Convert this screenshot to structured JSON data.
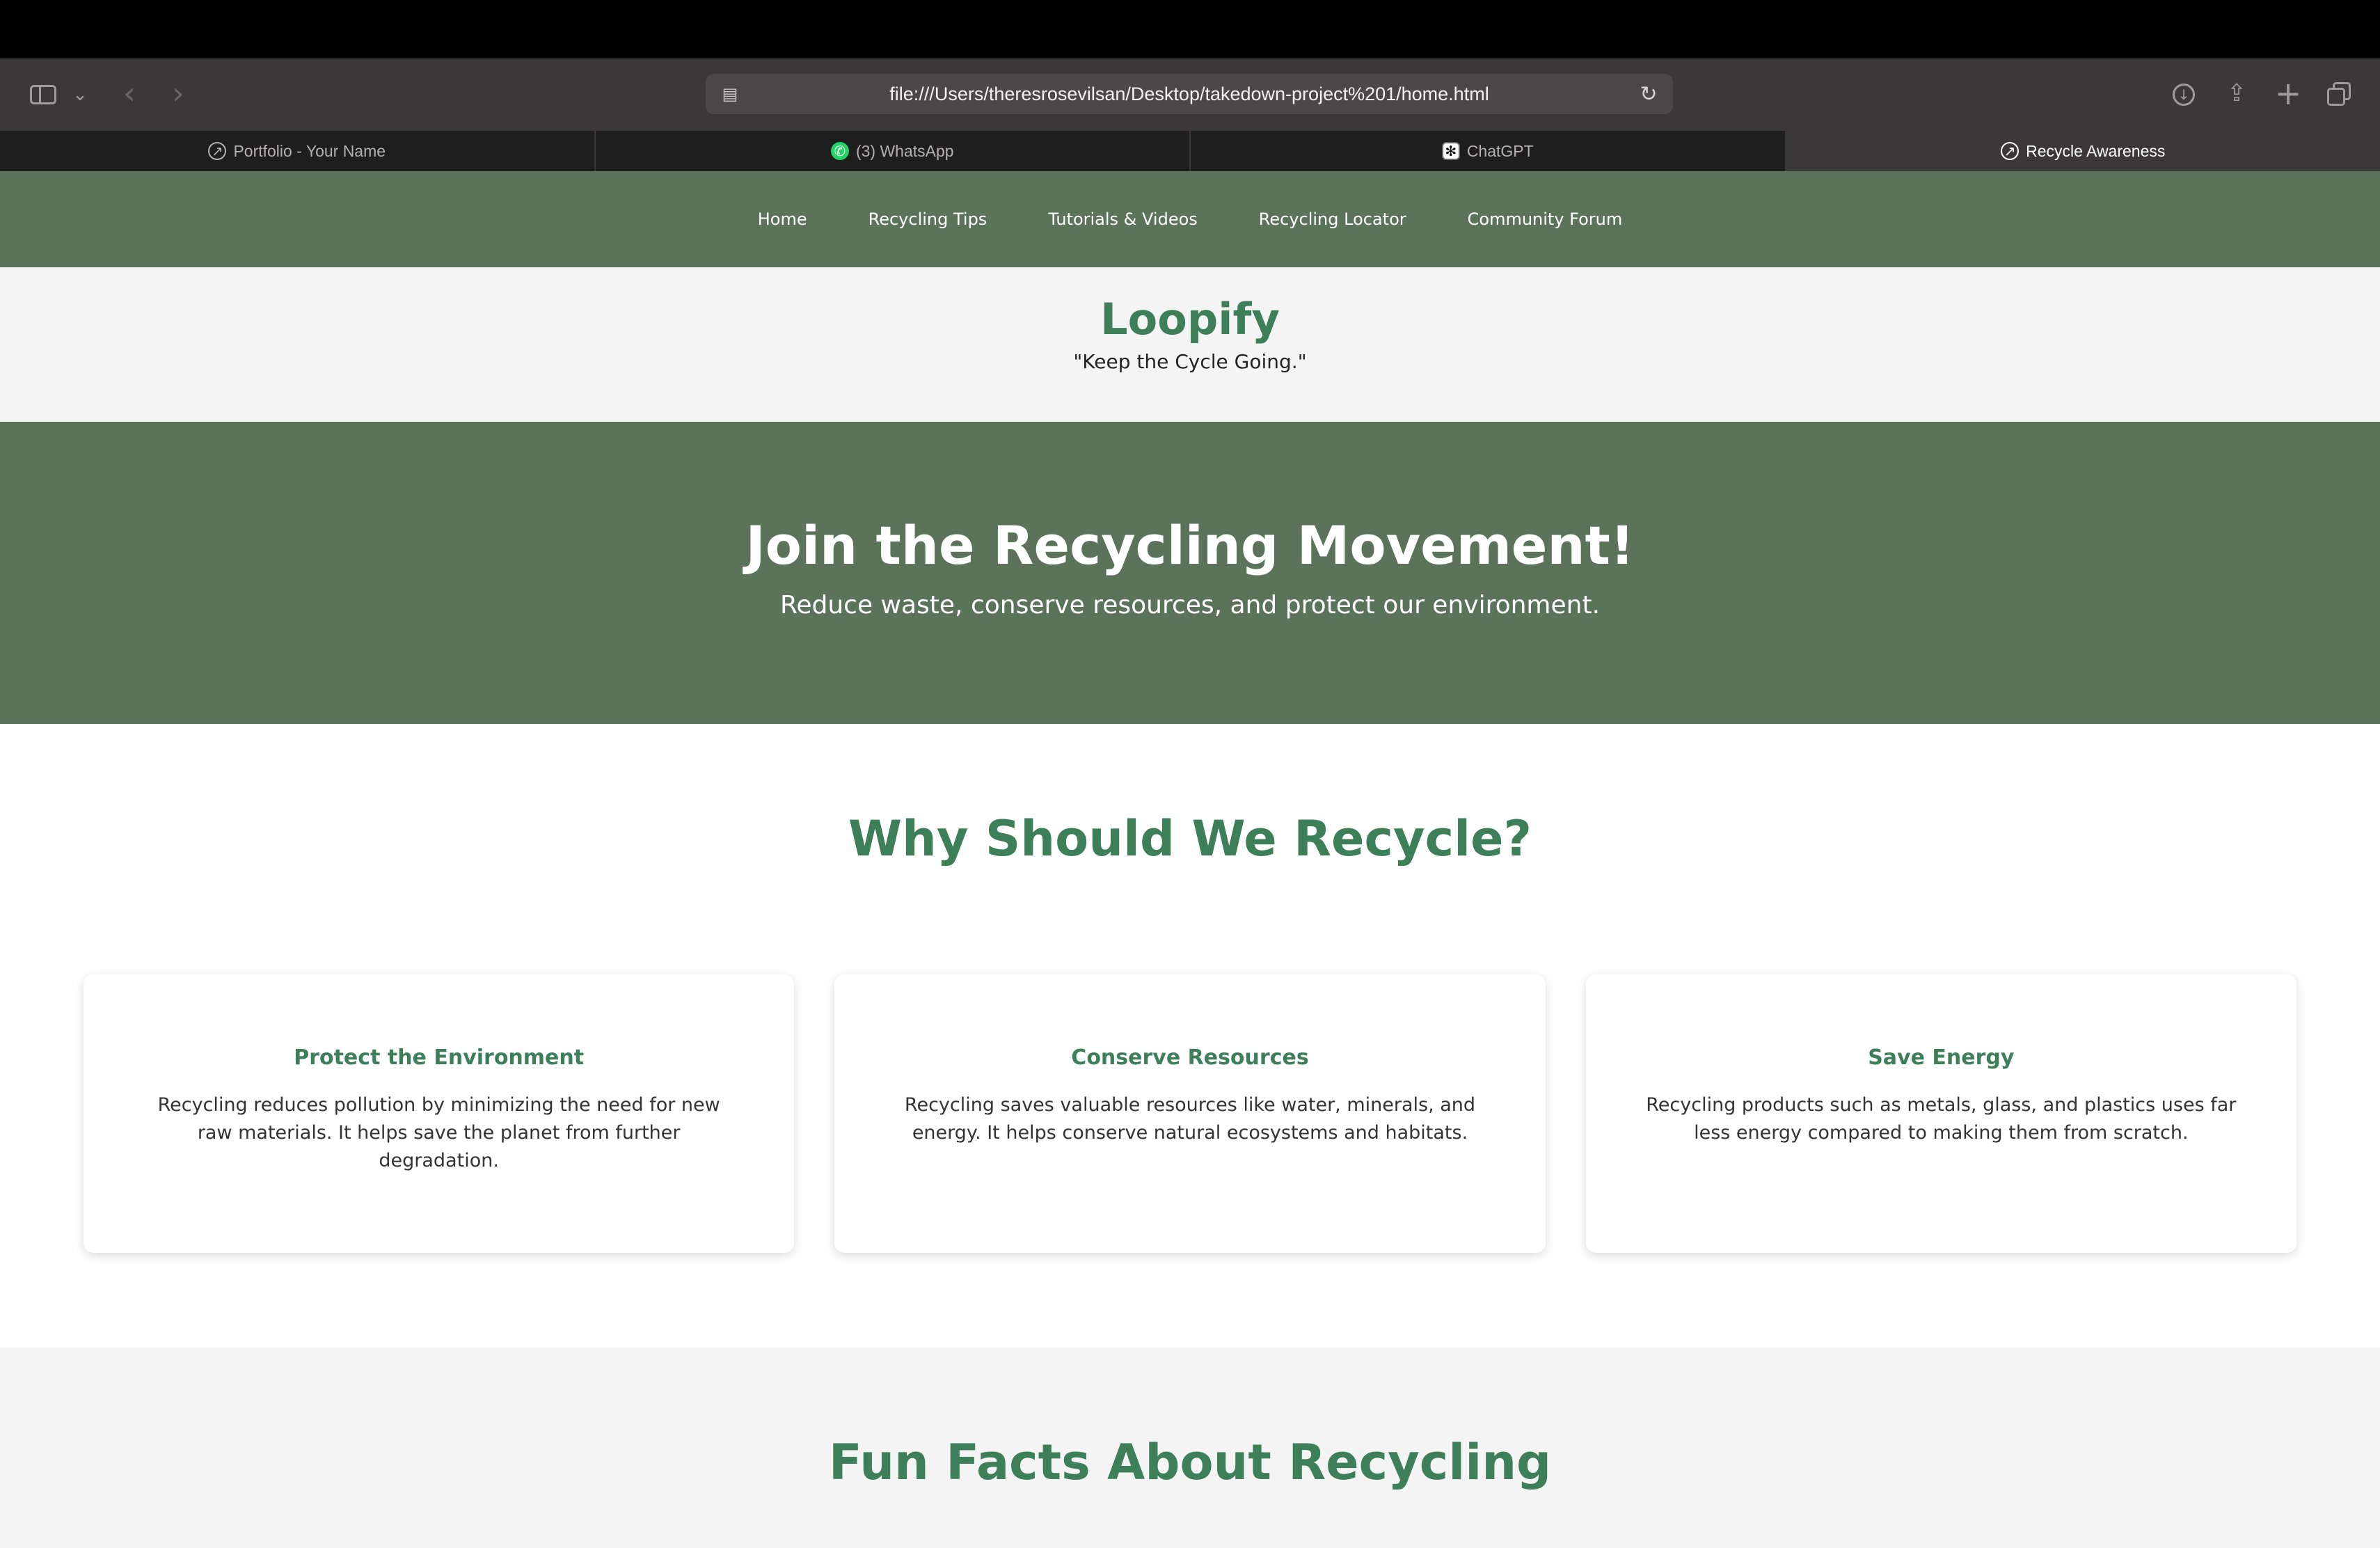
{
  "browser": {
    "url": "file:///Users/theresrosevilsan/Desktop/takedown-project%201/home.html",
    "tabs": [
      {
        "label": "Portfolio - Your Name",
        "icon": "compass-icon",
        "active": false
      },
      {
        "label": "(3) WhatsApp",
        "icon": "whatsapp-icon",
        "active": false
      },
      {
        "label": "ChatGPT",
        "icon": "chatgpt-icon",
        "active": false
      },
      {
        "label": "Recycle Awareness",
        "icon": "compass-icon",
        "active": true
      }
    ]
  },
  "nav": {
    "items": [
      "Home",
      "Recycling Tips",
      "Tutorials & Videos",
      "Recycling Locator",
      "Community Forum"
    ]
  },
  "brand": {
    "name": "Loopify",
    "tagline": "\"Keep the Cycle Going.\""
  },
  "hero": {
    "title": "Join the Recycling Movement!",
    "subtitle": "Reduce waste, conserve resources, and protect our environment."
  },
  "why": {
    "title": "Why Should We Recycle?",
    "cards": [
      {
        "title": "Protect the Environment",
        "text": "Recycling reduces pollution by minimizing the need for new raw materials. It helps save the planet from further degradation."
      },
      {
        "title": "Conserve Resources",
        "text": "Recycling saves valuable resources like water, minerals, and energy. It helps conserve natural ecosystems and habitats."
      },
      {
        "title": "Save Energy",
        "text": "Recycling products such as metals, glass, and plastics uses far less energy compared to making them from scratch."
      }
    ]
  },
  "facts": {
    "title": "Fun Facts About Recycling"
  },
  "colors": {
    "nav_bg": "#5c735b",
    "accent_green": "#3d7f58",
    "brand_bg": "#f4f4f4"
  }
}
